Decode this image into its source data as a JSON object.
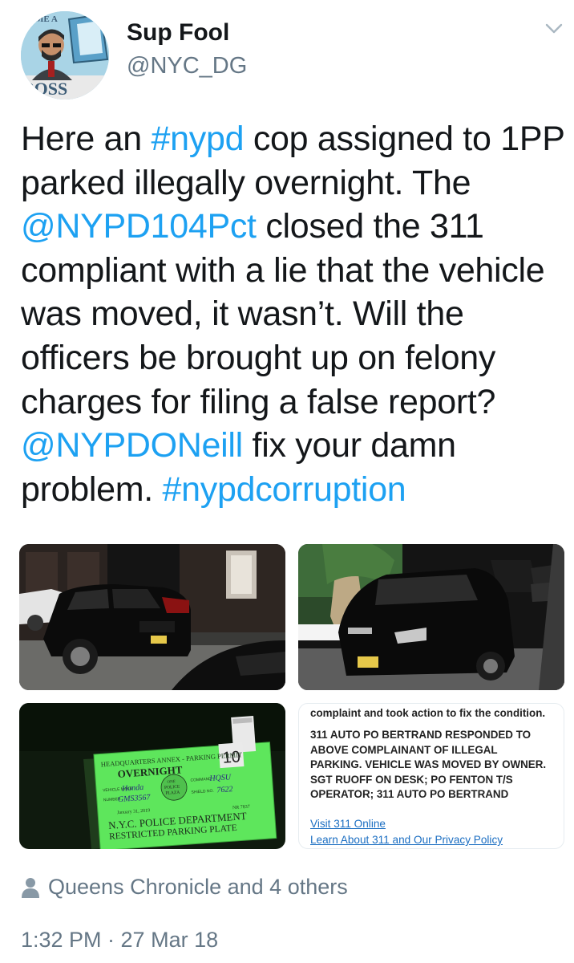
{
  "user": {
    "name": "Sup Fool",
    "handle": "@NYC_DG",
    "avatar_text_top": "ME A",
    "avatar_text_bottom": "BOSS"
  },
  "tweet": {
    "segments": [
      {
        "text": "Here an ",
        "type": "text"
      },
      {
        "text": "#nypd",
        "type": "hashtag"
      },
      {
        "text": " cop assigned to 1PP parked illegally overnight. The ",
        "type": "text"
      },
      {
        "text": "@NYPD104Pct",
        "type": "mention"
      },
      {
        "text": " closed the 311 compliant with a lie that the vehicle was moved, it wasn’t. Will the officers be brought up on felony charges for filing a false report?",
        "type": "text"
      },
      {
        "text": "@NYPDONeill",
        "type": "mention"
      },
      {
        "text": " fix your damn problem. ",
        "type": "text"
      },
      {
        "text": "#nypdcorruption",
        "type": "hashtag"
      }
    ]
  },
  "media": {
    "permit": {
      "header": "HEADQUARTERS ANNEX - PARKING PERMIT",
      "type": "OVERNIGHT",
      "vehicle_make_label": "VEHICLE MAKE",
      "vehicle_make": "Honda",
      "plate_label": "NUMBER",
      "plate": "GMS3567",
      "center_line1": "ONE",
      "center_line2": "POLICE",
      "center_line3": "PLAZA",
      "command_label": "COMMAND",
      "command": "HQSU",
      "shield_label": "SHIELD NO.",
      "shield": "7622",
      "expires": "January 31, 2019",
      "serial": "NR 7837",
      "dept": "N.Y.C. POLICE DEPARTMENT",
      "restricted": "RESTRICTED PARKING PLATE",
      "side_number": "10"
    },
    "screenshot_311": {
      "header": "complaint and took action to fix the condition.",
      "body": "311 AUTO PO BERTRAND RESPONDED TO ABOVE COMPLAINANT OF ILLEGAL PARKING. VEHICLE WAS MOVED BY OWNER. SGT RUOFF ON DESK; PO FENTON T/S OPERATOR; 311 AUTO PO BERTRAND",
      "link1": "Visit 311 Online",
      "link2": "Learn About 311 and Our Privacy Policy"
    }
  },
  "footer": {
    "liked_by": "Queens Chronicle and 4 others",
    "timestamp": "1:32 PM · 27 Mar 18"
  },
  "colors": {
    "link": "#1da1f2",
    "secondary_text": "#657786",
    "permit_green": "#5ee65c"
  }
}
